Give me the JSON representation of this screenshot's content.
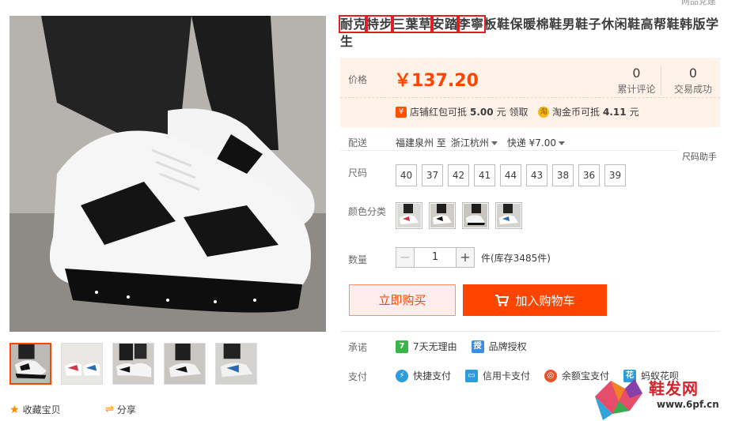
{
  "product": {
    "title_segments": [
      "耐克",
      "特步",
      "三葉草",
      "安踏",
      "李寧",
      "板鞋保暖棉鞋男鞋子休闲鞋高帮鞋韩版学生"
    ],
    "top_cut_text": "网品党建"
  },
  "price": {
    "label": "价格",
    "value": "￥137.20",
    "reviews_count": "0",
    "reviews_label": "累计评论",
    "sales_count": "0",
    "sales_label": "交易成功"
  },
  "promotions": [
    {
      "icon": "red-packet-icon",
      "icon_text": "¥",
      "text_pre": "店铺红包可抵",
      "amount": "5.00",
      "text_post": "元 领取"
    },
    {
      "icon": "taojinbi-coin-icon",
      "icon_text": "淘",
      "text_pre": "淘金币可抵",
      "amount": "4.11",
      "text_post": "元"
    }
  ],
  "delivery": {
    "label": "配送",
    "from": "福建泉州 至",
    "to": "浙江杭州",
    "shipping": "快递 ¥7.00"
  },
  "size": {
    "label": "尺码",
    "helper": "尺码助手",
    "options": [
      "40",
      "37",
      "42",
      "41",
      "44",
      "43",
      "38",
      "36",
      "39"
    ]
  },
  "color": {
    "label": "颜色分类"
  },
  "quantity": {
    "label": "数量",
    "minus": "−",
    "value": "1",
    "plus": "+",
    "stock": "件(库存3485件)"
  },
  "actions": {
    "buy_now": "立即购买",
    "add_to_cart": "加入购物车"
  },
  "promise": {
    "label": "承诺",
    "items": [
      {
        "icon": "seven-day-return-icon",
        "icon_text": "7",
        "text": "7天无理由",
        "color": "#3ab54a"
      },
      {
        "icon": "brand-authorized-icon",
        "icon_text": "授",
        "text": "品牌授权",
        "color": "#3a8ee6"
      }
    ]
  },
  "payment": {
    "label": "支付",
    "items": [
      {
        "icon": "quick-pay-icon",
        "icon_text": "⚡",
        "text": "快捷支付",
        "color": "#2d9cdb"
      },
      {
        "icon": "credit-card-icon",
        "icon_text": "▭",
        "text": "信用卡支付",
        "color": "#2d9cdb"
      },
      {
        "icon": "yuebao-icon",
        "icon_text": "◎",
        "text": "余额宝支付",
        "color": "#e8542a"
      },
      {
        "icon": "huabei-icon",
        "icon_text": "花",
        "text": "蚂蚁花呗",
        "color": "#2d9cdb"
      }
    ]
  },
  "footer": {
    "favorite": "收藏宝贝",
    "share": "分享"
  },
  "watermark": {
    "text": "鞋发网",
    "url": "www.6pf.cn"
  },
  "colors": {
    "accent": "#ff4400",
    "price_bg": "#fff2e8",
    "highlight_box": "#e02020"
  }
}
